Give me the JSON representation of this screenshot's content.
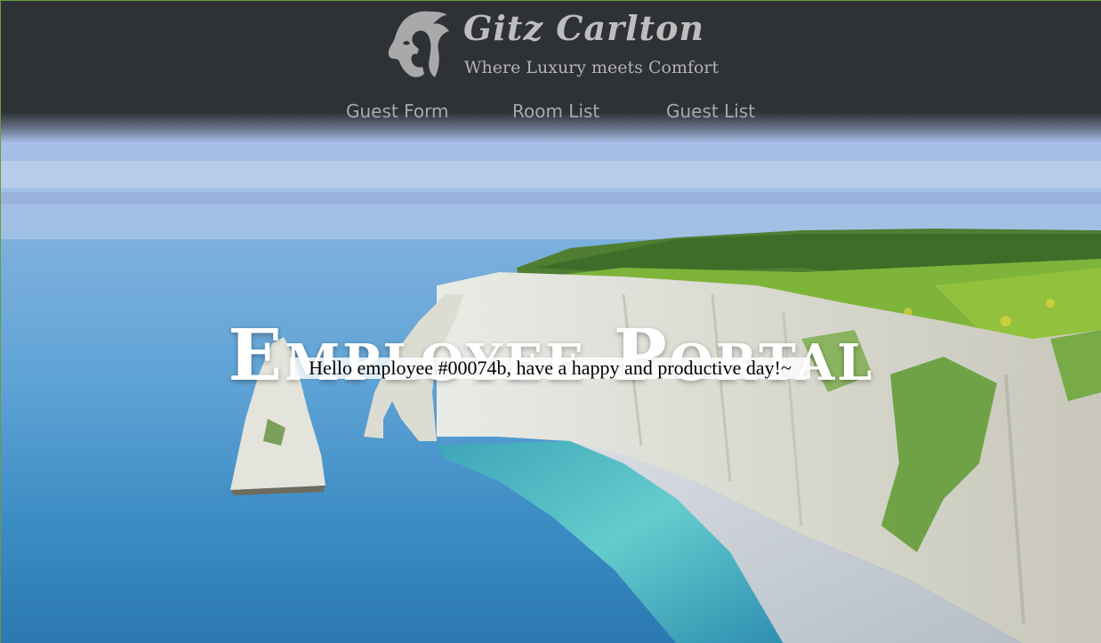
{
  "brand": {
    "name": "Gitz Carlton",
    "tagline": "Where Luxury meets Comfort",
    "logo_icon": "lion-head-icon"
  },
  "nav": {
    "items": [
      {
        "label": "Guest Form"
      },
      {
        "label": "Room List"
      },
      {
        "label": "Guest List"
      }
    ]
  },
  "hero": {
    "title": "Employee Portal",
    "greeting": "Hello employee #00074b, have a happy and productive day!~"
  },
  "colors": {
    "header_bg": "#2e3136",
    "nav_text": "#a9a9a9",
    "brand_text": "#bdbdbd"
  }
}
